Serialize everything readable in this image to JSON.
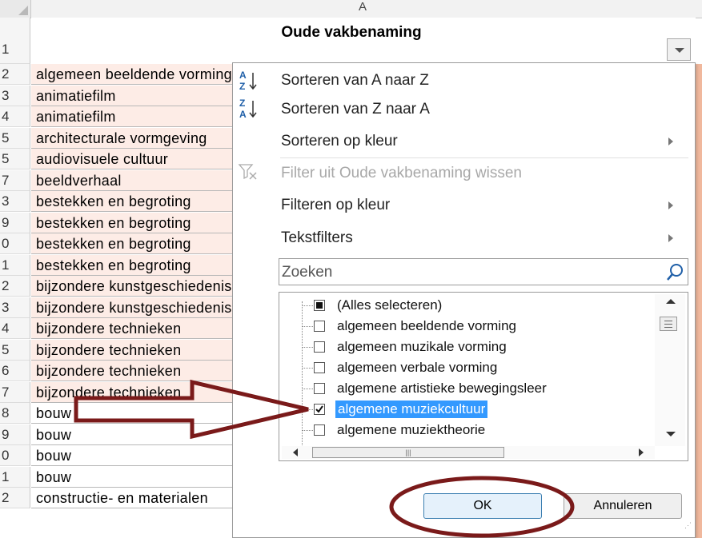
{
  "sheet": {
    "column_letter": "A",
    "header_row_number": "1",
    "header_title": "Oude vakbenaming",
    "rows": [
      {
        "num": "2",
        "text": "algemeen beeldende vorming"
      },
      {
        "num": "3",
        "text": "animatiefilm"
      },
      {
        "num": "4",
        "text": "animatiefilm"
      },
      {
        "num": "5",
        "text": "architecturale vormgeving"
      },
      {
        "num": "5",
        "text": "audiovisuele cultuur"
      },
      {
        "num": "7",
        "text": "beeldverhaal"
      },
      {
        "num": "3",
        "text": "bestekken en begroting"
      },
      {
        "num": "9",
        "text": "bestekken en begroting"
      },
      {
        "num": "0",
        "text": "bestekken en begroting"
      },
      {
        "num": "1",
        "text": "bestekken en begroting"
      },
      {
        "num": "2",
        "text": "bijzondere kunstgeschiedenis"
      },
      {
        "num": "3",
        "text": "bijzondere kunstgeschiedenis"
      },
      {
        "num": "4",
        "text": "bijzondere technieken"
      },
      {
        "num": "5",
        "text": "bijzondere technieken"
      },
      {
        "num": "6",
        "text": "bijzondere technieken"
      },
      {
        "num": "7",
        "text": "bijzondere technieken"
      },
      {
        "num": "8",
        "text": "bouw"
      },
      {
        "num": "9",
        "text": "bouw"
      },
      {
        "num": "0",
        "text": "bouw"
      },
      {
        "num": "1",
        "text": "bouw"
      },
      {
        "num": "2",
        "text": "constructie- en materialen"
      }
    ]
  },
  "filter_menu": {
    "sort_az": "Sorteren van A naar Z",
    "sort_za": "Sorteren van Z naar A",
    "sort_color": "Sorteren op kleur",
    "clear_filter": "Filter uit Oude vakbenaming wissen",
    "filter_color": "Filteren op kleur",
    "text_filters": "Tekstfilters",
    "search_placeholder": "Zoeken",
    "list_items": [
      {
        "label": "(Alles selecteren)",
        "state": "partial"
      },
      {
        "label": "algemeen beeldende vorming",
        "state": "unchecked"
      },
      {
        "label": "algemeen muzikale vorming",
        "state": "unchecked"
      },
      {
        "label": "algemeen verbale vorming",
        "state": "unchecked"
      },
      {
        "label": "algemene artistieke bewegingsleer",
        "state": "unchecked"
      },
      {
        "label": "algemene muziekcultuur",
        "state": "checked"
      },
      {
        "label": "algemene muziektheorie",
        "state": "unchecked"
      }
    ],
    "ok_label": "OK",
    "cancel_label": "Annuleren"
  },
  "annotations": {
    "arrow_color": "#7a1a1a",
    "ellipse_color": "#7a1a1a"
  }
}
